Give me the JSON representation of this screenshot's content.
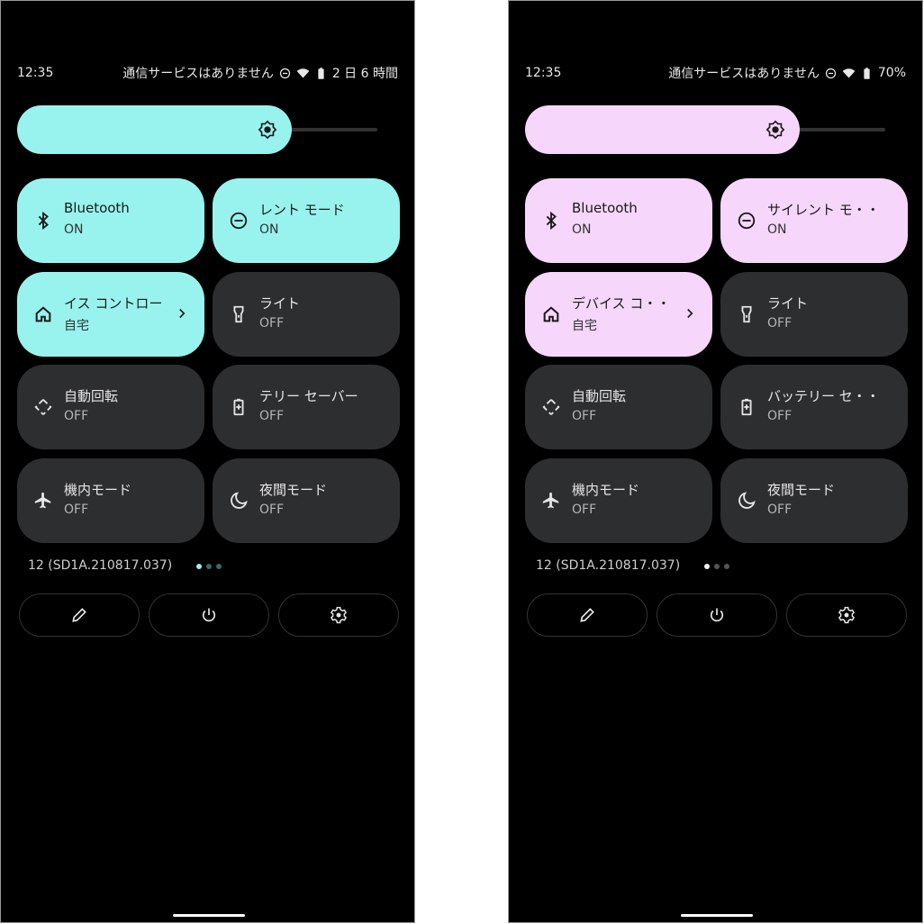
{
  "panels": [
    {
      "accent": "#98f3ee",
      "status": {
        "time": "12:35",
        "network": "通信サービスはありません",
        "battery": "2 日 6 時間"
      },
      "brightness_level": 0.73,
      "tiles": [
        {
          "title": "Bluetooth",
          "state": "ON",
          "on": true,
          "icon": "bluetooth-icon"
        },
        {
          "title": "レント モード",
          "state": "ON",
          "on": true,
          "icon": "do-not-disturb-icon"
        },
        {
          "title": "イス コントロー",
          "state": "自宅",
          "on": true,
          "icon": "home-icon",
          "chevron": true
        },
        {
          "title": "ライト",
          "state": "OFF",
          "on": false,
          "icon": "flashlight-icon"
        },
        {
          "title": "自動回転",
          "state": "OFF",
          "on": false,
          "icon": "auto-rotate-icon"
        },
        {
          "title": "テリー セーバー",
          "state": "OFF",
          "on": false,
          "icon": "battery-saver-icon"
        },
        {
          "title": "機内モード",
          "state": "OFF",
          "on": false,
          "icon": "airplane-icon"
        },
        {
          "title": "夜間モード",
          "state": "OFF",
          "on": false,
          "icon": "night-mode-icon"
        }
      ],
      "build": "12 (SD1A.210817.037)",
      "page_indicator": {
        "count": 3,
        "active": 0,
        "active_color": "#98f3ee",
        "inactive_color": "#3f6664"
      }
    },
    {
      "accent": "#f6d6fa",
      "status": {
        "time": "12:35",
        "network": "通信サービスはありません",
        "battery": "70%"
      },
      "brightness_level": 0.73,
      "tiles": [
        {
          "title": "Bluetooth",
          "state": "ON",
          "on": true,
          "icon": "bluetooth-icon"
        },
        {
          "title": "サイレント モ・・",
          "state": "ON",
          "on": true,
          "icon": "do-not-disturb-icon"
        },
        {
          "title": "デバイス コ・・",
          "state": "自宅",
          "on": true,
          "icon": "home-icon",
          "chevron": true
        },
        {
          "title": "ライト",
          "state": "OFF",
          "on": false,
          "icon": "flashlight-icon"
        },
        {
          "title": "自動回転",
          "state": "OFF",
          "on": false,
          "icon": "auto-rotate-icon"
        },
        {
          "title": "バッテリー セ・・",
          "state": "OFF",
          "on": false,
          "icon": "battery-saver-icon"
        },
        {
          "title": "機内モード",
          "state": "OFF",
          "on": false,
          "icon": "airplane-icon"
        },
        {
          "title": "夜間モード",
          "state": "OFF",
          "on": false,
          "icon": "night-mode-icon"
        }
      ],
      "build": "12 (SD1A.210817.037)",
      "page_indicator": {
        "count": 3,
        "active": 0,
        "active_color": "#f0f0f0",
        "inactive_color": "#555555"
      }
    }
  ],
  "buttons": [
    {
      "name": "edit-button",
      "icon": "pencil-icon"
    },
    {
      "name": "power-button",
      "icon": "power-icon"
    },
    {
      "name": "settings-button",
      "icon": "gear-icon"
    }
  ]
}
